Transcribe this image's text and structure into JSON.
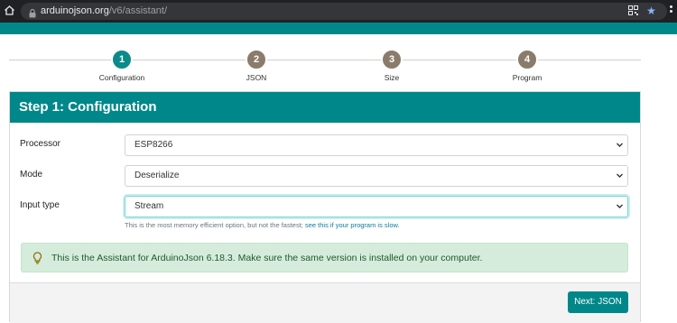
{
  "browser": {
    "url_host": "arduinojson.org",
    "url_path": "/v6/assistant/"
  },
  "stepper": {
    "steps": [
      {
        "number": "1",
        "label": "Configuration",
        "active": true
      },
      {
        "number": "2",
        "label": "JSON",
        "active": false
      },
      {
        "number": "3",
        "label": "Size",
        "active": false
      },
      {
        "number": "4",
        "label": "Program",
        "active": false
      }
    ]
  },
  "card": {
    "title": "Step 1: Configuration",
    "fields": {
      "processor": {
        "label": "Processor",
        "value": "ESP8266"
      },
      "mode": {
        "label": "Mode",
        "value": "Deserialize"
      },
      "input_type": {
        "label": "Input type",
        "value": "Stream"
      }
    },
    "help_text": "This is the most memory efficient option, but not the fastest;",
    "help_link": "see this if your program is slow.",
    "alert_text": "This is the Assistant for ArduinoJson 6.18.3. Make sure the same version is installed on your computer.",
    "next_button": "Next: JSON"
  },
  "colors": {
    "brand_teal": "#00878a",
    "step_inactive": "#8a7b6b",
    "alert_bg": "#d5ecdc"
  },
  "icons": {
    "home": "home-icon",
    "lock": "lock-icon",
    "qr": "qr-code-icon",
    "star": "bookmark-star-icon",
    "bulb": "lightbulb-icon",
    "caret": "chevron-down-icon"
  }
}
